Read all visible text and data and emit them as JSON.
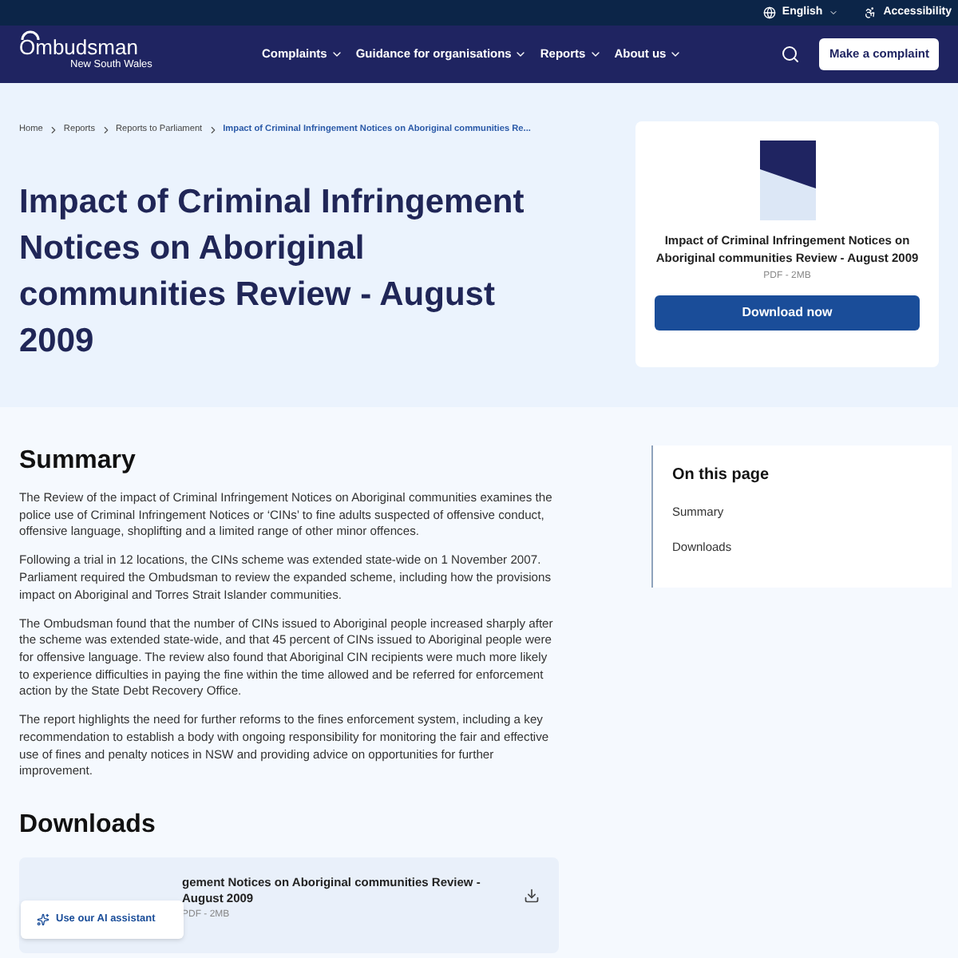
{
  "top_bar": {
    "items": [
      {
        "label": "English",
        "kind": "language"
      },
      {
        "label": "Accessibility",
        "kind": "accessibility"
      }
    ]
  },
  "header": {
    "logo": {
      "name": "Ombudsman",
      "subtitle": "New South Wales"
    },
    "nav": [
      {
        "label": "Complaints"
      },
      {
        "label": "Guidance for organisations"
      },
      {
        "label": "Reports"
      },
      {
        "label": "About us"
      }
    ],
    "cta": "Make a complaint"
  },
  "breadcrumb": [
    {
      "label": "Home",
      "current": false
    },
    {
      "label": "Reports",
      "current": false
    },
    {
      "label": "Reports to Parliament",
      "current": false
    },
    {
      "label": "Impact of Criminal Infringement Notices on Aboriginal communities Re...",
      "current": true
    }
  ],
  "title": "Impact of Criminal Infringement Notices on Aboriginal communities Review - August 2009",
  "download_card": {
    "title": "Impact of Criminal Infringement Notices on Aboriginal communities Review - August 2009",
    "meta": "PDF - 2MB",
    "button": "Download now"
  },
  "summary": {
    "heading": "Summary",
    "paragraphs": [
      "The Review of the impact of Criminal Infringement Notices on Aboriginal communities examines the police use of Criminal Infringement Notices or ‘CINs’ to fine adults suspected of offensive conduct, offensive language, shoplifting and a limited range of other minor offences.",
      "Following a trial in 12 locations, the CINs scheme was extended state-wide on 1 November 2007. Parliament required the Ombudsman to review the expanded scheme, including how the provisions impact on Aboriginal and Torres Strait Islander communities.",
      "The Ombudsman found that the number of CINs issued to Aboriginal people increased sharply after the scheme was extended state-wide, and that 45 percent of CINs issued to Aboriginal people were for offensive language. The review also found that Aboriginal CIN recipients were much more likely to experience difficulties in paying the fine within the time allowed and be referred for enforcement action by the State Debt Recovery Office.",
      "The report highlights the need for further reforms to the fines enforcement system, including a key recommendation to establish a body with ongoing responsibility for monitoring the fair and effective use of fines and penalty notices in NSW and providing advice on opportunities for further improvement."
    ]
  },
  "on_this_page": {
    "heading": "On this page",
    "links": [
      "Summary",
      "Downloads"
    ]
  },
  "downloads": {
    "heading": "Downloads",
    "items": [
      {
        "title": "gement Notices on Aboriginal communities Review - August 2009",
        "meta": "PDF - 2MB"
      }
    ]
  },
  "assistant_button": "Use our AI assistant"
}
